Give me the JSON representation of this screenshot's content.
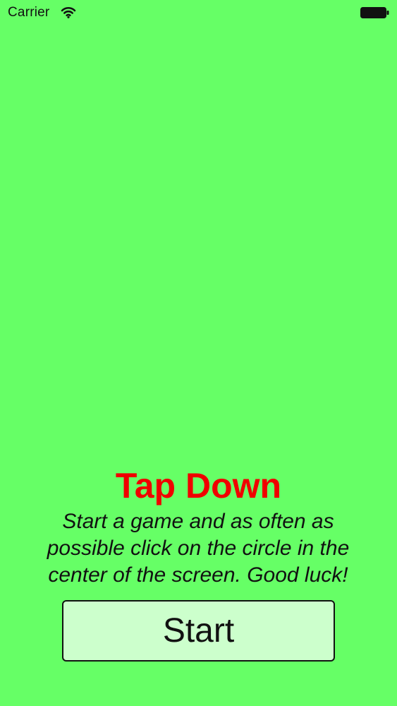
{
  "status_bar": {
    "carrier": "Carrier",
    "wifi_icon": "wifi-icon",
    "battery_icon": "battery-icon"
  },
  "main": {
    "title": "Tap Down",
    "description": "Start a game and as often as possible click on the circle in the center of the screen. Good luck!",
    "start_button_label": "Start"
  },
  "colors": {
    "background": "#66ff66",
    "title": "#f00000",
    "button_background": "#ccffcc"
  }
}
